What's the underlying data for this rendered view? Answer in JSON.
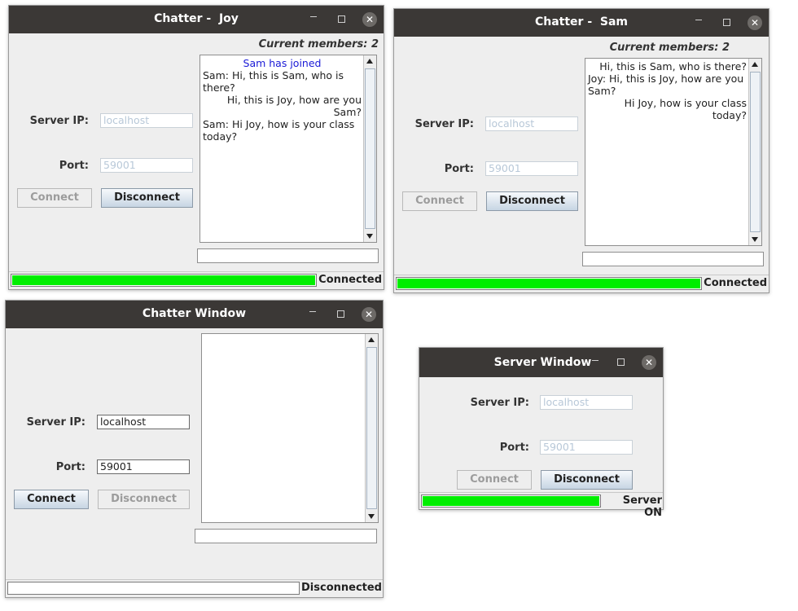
{
  "windows": {
    "joy": {
      "title": "Chatter -  Joy",
      "members": "Current members: 2",
      "server_ip_label": "Server IP:",
      "server_ip_value": "localhost",
      "port_label": "Port:",
      "port_value": "59001",
      "connect_label": "Connect",
      "disconnect_label": "Disconnect",
      "chat": [
        {
          "text": "Sam has joined",
          "style": "join"
        },
        {
          "text": "Sam: Hi, this is Sam, who is there?",
          "style": "left"
        },
        {
          "text": "Hi, this is Joy, how are you Sam?",
          "style": "right"
        },
        {
          "text": "Sam: Hi Joy, how is your class today?",
          "style": "left"
        }
      ],
      "status_text": "Connected",
      "status_progress": 1.0
    },
    "sam": {
      "title": "Chatter -  Sam",
      "members": "Current members: 2",
      "server_ip_label": "Server IP:",
      "server_ip_value": "localhost",
      "port_label": "Port:",
      "port_value": "59001",
      "connect_label": "Connect",
      "disconnect_label": "Disconnect",
      "chat": [
        {
          "text": "Hi, this is Sam, who is there?",
          "style": "right"
        },
        {
          "text": "Joy: Hi, this is Joy, how are you Sam?",
          "style": "left"
        },
        {
          "text": "Hi Joy, how is your class today?",
          "style": "right"
        }
      ],
      "status_text": "Connected",
      "status_progress": 1.0
    },
    "chatter": {
      "title": "Chatter Window",
      "server_ip_label": "Server IP:",
      "server_ip_value": "localhost",
      "port_label": "Port:",
      "port_value": "59001",
      "connect_label": "Connect",
      "disconnect_label": "Disconnect",
      "status_text": "Disconnected",
      "status_progress": 0.0
    },
    "server": {
      "title": "Server Window",
      "server_ip_label": "Server IP:",
      "server_ip_value": "localhost",
      "port_label": "Port:",
      "port_value": "59001",
      "connect_label": "Connect",
      "disconnect_label": "Disconnect",
      "status_text": "Server ON",
      "status_progress": 1.0
    }
  },
  "icons": {
    "minimize": "minimize-icon",
    "maximize": "maximize-icon",
    "close": "close-icon"
  },
  "colors": {
    "titlebar": "#3b3836",
    "progress": "#00ee00",
    "join_text": "#1a1ad6"
  }
}
